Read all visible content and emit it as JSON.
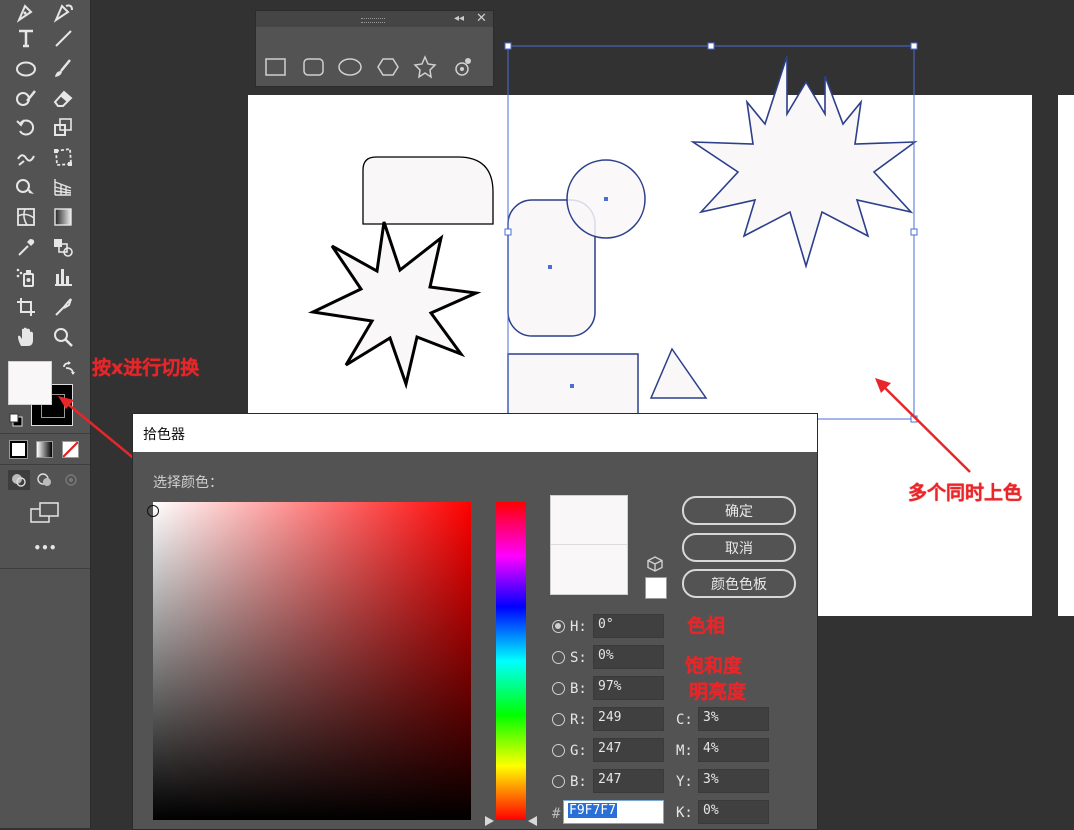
{
  "toolbar": {
    "tools": [
      "pen-tool-icon",
      "curvature-tool-icon",
      "type-tool-icon",
      "line-segment-tool-icon",
      "ellipse-tool-icon",
      "paintbrush-tool-icon",
      "shaper-tool-icon",
      "eraser-tool-icon",
      "rotate-tool-icon",
      "scale-tool-icon",
      "warp-tool-icon",
      "free-transform-tool-icon",
      "shape-builder-tool-icon",
      "perspective-grid-tool-icon",
      "mesh-tool-icon",
      "gradient-tool-icon",
      "eyedropper-tool-icon",
      "blend-tool-icon",
      "symbol-sprayer-tool-icon",
      "column-graph-tool-icon",
      "artboard-tool-icon",
      "slice-tool-icon",
      "hand-tool-icon",
      "zoom-tool-icon"
    ],
    "fill_color": "#f9f7f7",
    "stroke_color": "#000000",
    "more_label": "•••"
  },
  "annotations": {
    "toggle_hint": "按x进行切换",
    "multi_color": "多个同时上色",
    "hue": "色相",
    "saturation": "饱和度",
    "brightness": "明亮度",
    "accent_color": "#e8262a"
  },
  "color_picker": {
    "title": "拾色器",
    "select_label": "选择颜色：",
    "ok_label": "确定",
    "cancel_label": "取消",
    "swatches_label": "颜色色板",
    "current_color": "#f9f7f7",
    "hsb": [
      {
        "label": "H:",
        "value": "0°"
      },
      {
        "label": "S:",
        "value": "0%"
      },
      {
        "label": "B:",
        "value": "97%"
      }
    ],
    "rgb": [
      {
        "label": "R:",
        "value": "249"
      },
      {
        "label": "G:",
        "value": "247"
      },
      {
        "label": "B:",
        "value": "247"
      }
    ],
    "cmyk": [
      {
        "label": "C:",
        "value": "3%"
      },
      {
        "label": "M:",
        "value": "4%"
      },
      {
        "label": "Y:",
        "value": "3%"
      },
      {
        "label": "K:",
        "value": "0%"
      }
    ],
    "hex_prefix": "#",
    "hex_value": "F9F7F7"
  }
}
